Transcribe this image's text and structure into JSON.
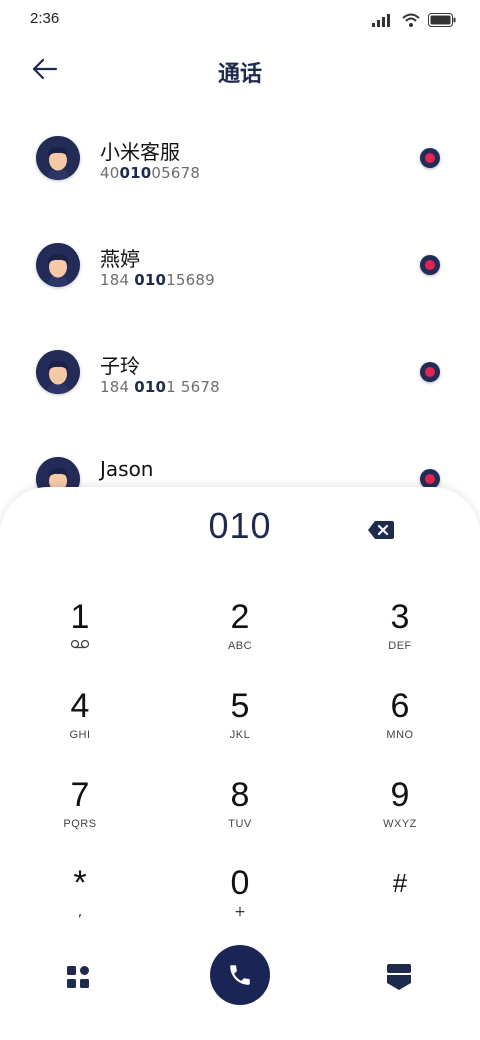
{
  "status_bar": {
    "time": "2:36"
  },
  "header": {
    "title": "通话",
    "back_icon": "arrow-left-icon"
  },
  "contacts": [
    {
      "name": "小米客服",
      "number_pre": "40",
      "number_hl": "010",
      "number_post": "05678"
    },
    {
      "name": "燕婷",
      "number_pre": "184 ",
      "number_hl": "010",
      "number_post": "15689"
    },
    {
      "name": "子玲",
      "number_pre": "184 ",
      "number_hl": "010",
      "number_post": "1 5678"
    },
    {
      "name": "Jason",
      "number_pre": "",
      "number_hl": "",
      "number_post": ""
    }
  ],
  "dialpad": {
    "display": "010",
    "keys": [
      {
        "digit": "1",
        "letters": ""
      },
      {
        "digit": "2",
        "letters": "ABC"
      },
      {
        "digit": "3",
        "letters": "DEF"
      },
      {
        "digit": "4",
        "letters": "GHI"
      },
      {
        "digit": "5",
        "letters": "JKL"
      },
      {
        "digit": "6",
        "letters": "MNO"
      },
      {
        "digit": "7",
        "letters": "PQRS"
      },
      {
        "digit": "8",
        "letters": "TUV"
      },
      {
        "digit": "9",
        "letters": "WXYZ"
      },
      {
        "digit": "*",
        "letters": ","
      },
      {
        "digit": "0",
        "letters": "+"
      },
      {
        "digit": "#",
        "letters": ""
      }
    ]
  },
  "colors": {
    "accent_navy": "#1a2555",
    "record_red": "#e0264f",
    "highlight": "#1f2b4d"
  }
}
